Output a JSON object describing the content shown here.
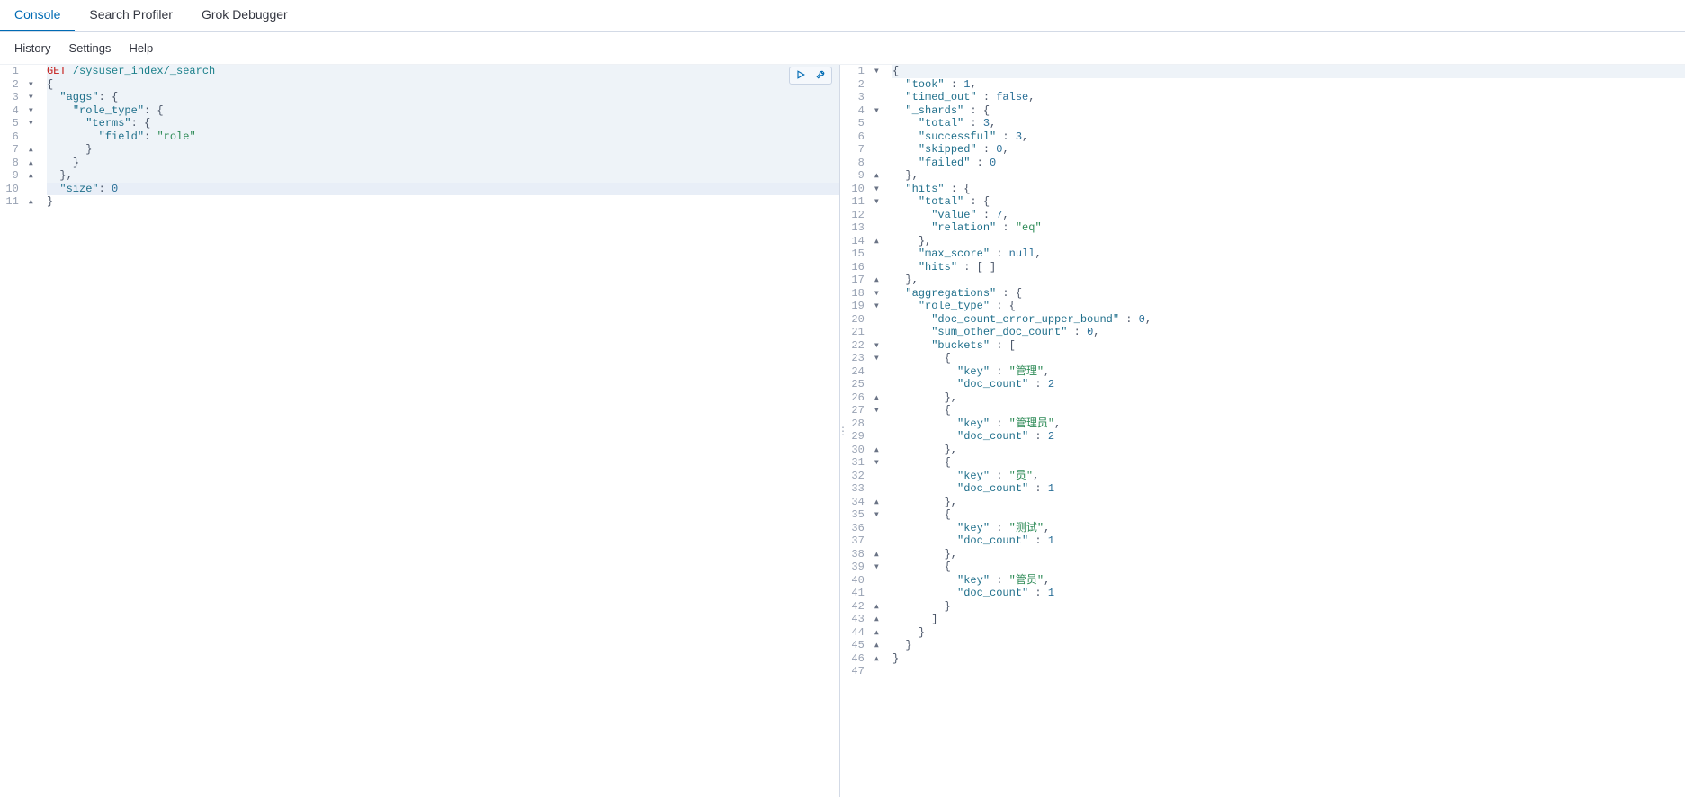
{
  "tabs": {
    "console": "Console",
    "searchProfiler": "Search Profiler",
    "grokDebugger": "Grok Debugger",
    "active": "console"
  },
  "subMenu": {
    "history": "History",
    "settings": "Settings",
    "help": "Help"
  },
  "actions": {
    "runTitle": "Click to send request",
    "wrenchTitle": "Options"
  },
  "request": {
    "method": "GET",
    "path": "/sysuser_index/_search",
    "lines": [
      {
        "n": 1,
        "fold": "",
        "hl": true,
        "tokens": [
          {
            "t": "method",
            "v": "GET"
          },
          {
            "t": "plain",
            "v": " "
          },
          {
            "t": "path",
            "v": "/sysuser_index/_search"
          }
        ]
      },
      {
        "n": 2,
        "fold": "▾",
        "hl": true,
        "tokens": [
          {
            "t": "punc",
            "v": "{"
          }
        ]
      },
      {
        "n": 3,
        "fold": "▾",
        "hl": true,
        "tokens": [
          {
            "t": "plain",
            "v": "  "
          },
          {
            "t": "key",
            "v": "\"aggs\""
          },
          {
            "t": "punc",
            "v": ": {"
          }
        ]
      },
      {
        "n": 4,
        "fold": "▾",
        "hl": true,
        "tokens": [
          {
            "t": "plain",
            "v": "    "
          },
          {
            "t": "key",
            "v": "\"role_type\""
          },
          {
            "t": "punc",
            "v": ": {"
          }
        ]
      },
      {
        "n": 5,
        "fold": "▾",
        "hl": true,
        "tokens": [
          {
            "t": "plain",
            "v": "      "
          },
          {
            "t": "key",
            "v": "\"terms\""
          },
          {
            "t": "punc",
            "v": ": {"
          }
        ]
      },
      {
        "n": 6,
        "fold": "",
        "hl": true,
        "tokens": [
          {
            "t": "plain",
            "v": "        "
          },
          {
            "t": "key",
            "v": "\"field\""
          },
          {
            "t": "punc",
            "v": ": "
          },
          {
            "t": "str",
            "v": "\"role\""
          }
        ]
      },
      {
        "n": 7,
        "fold": "▴",
        "hl": true,
        "tokens": [
          {
            "t": "plain",
            "v": "      "
          },
          {
            "t": "punc",
            "v": "}"
          }
        ]
      },
      {
        "n": 8,
        "fold": "▴",
        "hl": true,
        "tokens": [
          {
            "t": "plain",
            "v": "    "
          },
          {
            "t": "punc",
            "v": "}"
          }
        ]
      },
      {
        "n": 9,
        "fold": "▴",
        "hl": true,
        "tokens": [
          {
            "t": "plain",
            "v": "  "
          },
          {
            "t": "punc",
            "v": "},"
          }
        ]
      },
      {
        "n": 10,
        "fold": "",
        "hl": true,
        "cursor": true,
        "tokens": [
          {
            "t": "plain",
            "v": "  "
          },
          {
            "t": "key",
            "v": "\"size\""
          },
          {
            "t": "punc",
            "v": ": "
          },
          {
            "t": "num",
            "v": "0"
          }
        ]
      },
      {
        "n": 11,
        "fold": "▴",
        "hl": false,
        "tokens": [
          {
            "t": "punc",
            "v": "}"
          }
        ]
      }
    ]
  },
  "response": {
    "lines": [
      {
        "n": 1,
        "fold": "▾",
        "hl": true,
        "tokens": [
          {
            "t": "punc",
            "v": "{"
          }
        ]
      },
      {
        "n": 2,
        "fold": "",
        "tokens": [
          {
            "t": "plain",
            "v": "  "
          },
          {
            "t": "key",
            "v": "\"took\""
          },
          {
            "t": "punc",
            "v": " : "
          },
          {
            "t": "num",
            "v": "1"
          },
          {
            "t": "punc",
            "v": ","
          }
        ]
      },
      {
        "n": 3,
        "fold": "",
        "tokens": [
          {
            "t": "plain",
            "v": "  "
          },
          {
            "t": "key",
            "v": "\"timed_out\""
          },
          {
            "t": "punc",
            "v": " : "
          },
          {
            "t": "bool",
            "v": "false"
          },
          {
            "t": "punc",
            "v": ","
          }
        ]
      },
      {
        "n": 4,
        "fold": "▾",
        "tokens": [
          {
            "t": "plain",
            "v": "  "
          },
          {
            "t": "key",
            "v": "\"_shards\""
          },
          {
            "t": "punc",
            "v": " : {"
          }
        ]
      },
      {
        "n": 5,
        "fold": "",
        "tokens": [
          {
            "t": "plain",
            "v": "    "
          },
          {
            "t": "key",
            "v": "\"total\""
          },
          {
            "t": "punc",
            "v": " : "
          },
          {
            "t": "num",
            "v": "3"
          },
          {
            "t": "punc",
            "v": ","
          }
        ]
      },
      {
        "n": 6,
        "fold": "",
        "tokens": [
          {
            "t": "plain",
            "v": "    "
          },
          {
            "t": "key",
            "v": "\"successful\""
          },
          {
            "t": "punc",
            "v": " : "
          },
          {
            "t": "num",
            "v": "3"
          },
          {
            "t": "punc",
            "v": ","
          }
        ]
      },
      {
        "n": 7,
        "fold": "",
        "tokens": [
          {
            "t": "plain",
            "v": "    "
          },
          {
            "t": "key",
            "v": "\"skipped\""
          },
          {
            "t": "punc",
            "v": " : "
          },
          {
            "t": "num",
            "v": "0"
          },
          {
            "t": "punc",
            "v": ","
          }
        ]
      },
      {
        "n": 8,
        "fold": "",
        "tokens": [
          {
            "t": "plain",
            "v": "    "
          },
          {
            "t": "key",
            "v": "\"failed\""
          },
          {
            "t": "punc",
            "v": " : "
          },
          {
            "t": "num",
            "v": "0"
          }
        ]
      },
      {
        "n": 9,
        "fold": "▴",
        "tokens": [
          {
            "t": "plain",
            "v": "  "
          },
          {
            "t": "punc",
            "v": "},"
          }
        ]
      },
      {
        "n": 10,
        "fold": "▾",
        "tokens": [
          {
            "t": "plain",
            "v": "  "
          },
          {
            "t": "key",
            "v": "\"hits\""
          },
          {
            "t": "punc",
            "v": " : {"
          }
        ]
      },
      {
        "n": 11,
        "fold": "▾",
        "tokens": [
          {
            "t": "plain",
            "v": "    "
          },
          {
            "t": "key",
            "v": "\"total\""
          },
          {
            "t": "punc",
            "v": " : {"
          }
        ]
      },
      {
        "n": 12,
        "fold": "",
        "tokens": [
          {
            "t": "plain",
            "v": "      "
          },
          {
            "t": "key",
            "v": "\"value\""
          },
          {
            "t": "punc",
            "v": " : "
          },
          {
            "t": "num",
            "v": "7"
          },
          {
            "t": "punc",
            "v": ","
          }
        ]
      },
      {
        "n": 13,
        "fold": "",
        "tokens": [
          {
            "t": "plain",
            "v": "      "
          },
          {
            "t": "key",
            "v": "\"relation\""
          },
          {
            "t": "punc",
            "v": " : "
          },
          {
            "t": "str",
            "v": "\"eq\""
          }
        ]
      },
      {
        "n": 14,
        "fold": "▴",
        "tokens": [
          {
            "t": "plain",
            "v": "    "
          },
          {
            "t": "punc",
            "v": "},"
          }
        ]
      },
      {
        "n": 15,
        "fold": "",
        "tokens": [
          {
            "t": "plain",
            "v": "    "
          },
          {
            "t": "key",
            "v": "\"max_score\""
          },
          {
            "t": "punc",
            "v": " : "
          },
          {
            "t": "null",
            "v": "null"
          },
          {
            "t": "punc",
            "v": ","
          }
        ]
      },
      {
        "n": 16,
        "fold": "",
        "tokens": [
          {
            "t": "plain",
            "v": "    "
          },
          {
            "t": "key",
            "v": "\"hits\""
          },
          {
            "t": "punc",
            "v": " : [ ]"
          }
        ]
      },
      {
        "n": 17,
        "fold": "▴",
        "tokens": [
          {
            "t": "plain",
            "v": "  "
          },
          {
            "t": "punc",
            "v": "},"
          }
        ]
      },
      {
        "n": 18,
        "fold": "▾",
        "tokens": [
          {
            "t": "plain",
            "v": "  "
          },
          {
            "t": "key",
            "v": "\"aggregations\""
          },
          {
            "t": "punc",
            "v": " : {"
          }
        ]
      },
      {
        "n": 19,
        "fold": "▾",
        "tokens": [
          {
            "t": "plain",
            "v": "    "
          },
          {
            "t": "key",
            "v": "\"role_type\""
          },
          {
            "t": "punc",
            "v": " : {"
          }
        ]
      },
      {
        "n": 20,
        "fold": "",
        "tokens": [
          {
            "t": "plain",
            "v": "      "
          },
          {
            "t": "key",
            "v": "\"doc_count_error_upper_bound\""
          },
          {
            "t": "punc",
            "v": " : "
          },
          {
            "t": "num",
            "v": "0"
          },
          {
            "t": "punc",
            "v": ","
          }
        ]
      },
      {
        "n": 21,
        "fold": "",
        "tokens": [
          {
            "t": "plain",
            "v": "      "
          },
          {
            "t": "key",
            "v": "\"sum_other_doc_count\""
          },
          {
            "t": "punc",
            "v": " : "
          },
          {
            "t": "num",
            "v": "0"
          },
          {
            "t": "punc",
            "v": ","
          }
        ]
      },
      {
        "n": 22,
        "fold": "▾",
        "tokens": [
          {
            "t": "plain",
            "v": "      "
          },
          {
            "t": "key",
            "v": "\"buckets\""
          },
          {
            "t": "punc",
            "v": " : ["
          }
        ]
      },
      {
        "n": 23,
        "fold": "▾",
        "tokens": [
          {
            "t": "plain",
            "v": "        "
          },
          {
            "t": "punc",
            "v": "{"
          }
        ]
      },
      {
        "n": 24,
        "fold": "",
        "tokens": [
          {
            "t": "plain",
            "v": "          "
          },
          {
            "t": "key",
            "v": "\"key\""
          },
          {
            "t": "punc",
            "v": " : "
          },
          {
            "t": "str",
            "v": "\"管理\""
          },
          {
            "t": "punc",
            "v": ","
          }
        ]
      },
      {
        "n": 25,
        "fold": "",
        "tokens": [
          {
            "t": "plain",
            "v": "          "
          },
          {
            "t": "key",
            "v": "\"doc_count\""
          },
          {
            "t": "punc",
            "v": " : "
          },
          {
            "t": "num",
            "v": "2"
          }
        ]
      },
      {
        "n": 26,
        "fold": "▴",
        "tokens": [
          {
            "t": "plain",
            "v": "        "
          },
          {
            "t": "punc",
            "v": "},"
          }
        ]
      },
      {
        "n": 27,
        "fold": "▾",
        "tokens": [
          {
            "t": "plain",
            "v": "        "
          },
          {
            "t": "punc",
            "v": "{"
          }
        ]
      },
      {
        "n": 28,
        "fold": "",
        "tokens": [
          {
            "t": "plain",
            "v": "          "
          },
          {
            "t": "key",
            "v": "\"key\""
          },
          {
            "t": "punc",
            "v": " : "
          },
          {
            "t": "str",
            "v": "\"管理员\""
          },
          {
            "t": "punc",
            "v": ","
          }
        ]
      },
      {
        "n": 29,
        "fold": "",
        "tokens": [
          {
            "t": "plain",
            "v": "          "
          },
          {
            "t": "key",
            "v": "\"doc_count\""
          },
          {
            "t": "punc",
            "v": " : "
          },
          {
            "t": "num",
            "v": "2"
          }
        ]
      },
      {
        "n": 30,
        "fold": "▴",
        "tokens": [
          {
            "t": "plain",
            "v": "        "
          },
          {
            "t": "punc",
            "v": "},"
          }
        ]
      },
      {
        "n": 31,
        "fold": "▾",
        "tokens": [
          {
            "t": "plain",
            "v": "        "
          },
          {
            "t": "punc",
            "v": "{"
          }
        ]
      },
      {
        "n": 32,
        "fold": "",
        "tokens": [
          {
            "t": "plain",
            "v": "          "
          },
          {
            "t": "key",
            "v": "\"key\""
          },
          {
            "t": "punc",
            "v": " : "
          },
          {
            "t": "str",
            "v": "\"员\""
          },
          {
            "t": "punc",
            "v": ","
          }
        ]
      },
      {
        "n": 33,
        "fold": "",
        "tokens": [
          {
            "t": "plain",
            "v": "          "
          },
          {
            "t": "key",
            "v": "\"doc_count\""
          },
          {
            "t": "punc",
            "v": " : "
          },
          {
            "t": "num",
            "v": "1"
          }
        ]
      },
      {
        "n": 34,
        "fold": "▴",
        "tokens": [
          {
            "t": "plain",
            "v": "        "
          },
          {
            "t": "punc",
            "v": "},"
          }
        ]
      },
      {
        "n": 35,
        "fold": "▾",
        "tokens": [
          {
            "t": "plain",
            "v": "        "
          },
          {
            "t": "punc",
            "v": "{"
          }
        ]
      },
      {
        "n": 36,
        "fold": "",
        "tokens": [
          {
            "t": "plain",
            "v": "          "
          },
          {
            "t": "key",
            "v": "\"key\""
          },
          {
            "t": "punc",
            "v": " : "
          },
          {
            "t": "str",
            "v": "\"测试\""
          },
          {
            "t": "punc",
            "v": ","
          }
        ]
      },
      {
        "n": 37,
        "fold": "",
        "tokens": [
          {
            "t": "plain",
            "v": "          "
          },
          {
            "t": "key",
            "v": "\"doc_count\""
          },
          {
            "t": "punc",
            "v": " : "
          },
          {
            "t": "num",
            "v": "1"
          }
        ]
      },
      {
        "n": 38,
        "fold": "▴",
        "tokens": [
          {
            "t": "plain",
            "v": "        "
          },
          {
            "t": "punc",
            "v": "},"
          }
        ]
      },
      {
        "n": 39,
        "fold": "▾",
        "tokens": [
          {
            "t": "plain",
            "v": "        "
          },
          {
            "t": "punc",
            "v": "{"
          }
        ]
      },
      {
        "n": 40,
        "fold": "",
        "tokens": [
          {
            "t": "plain",
            "v": "          "
          },
          {
            "t": "key",
            "v": "\"key\""
          },
          {
            "t": "punc",
            "v": " : "
          },
          {
            "t": "str",
            "v": "\"管员\""
          },
          {
            "t": "punc",
            "v": ","
          }
        ]
      },
      {
        "n": 41,
        "fold": "",
        "tokens": [
          {
            "t": "plain",
            "v": "          "
          },
          {
            "t": "key",
            "v": "\"doc_count\""
          },
          {
            "t": "punc",
            "v": " : "
          },
          {
            "t": "num",
            "v": "1"
          }
        ]
      },
      {
        "n": 42,
        "fold": "▴",
        "tokens": [
          {
            "t": "plain",
            "v": "        "
          },
          {
            "t": "punc",
            "v": "}"
          }
        ]
      },
      {
        "n": 43,
        "fold": "▴",
        "tokens": [
          {
            "t": "plain",
            "v": "      "
          },
          {
            "t": "punc",
            "v": "]"
          }
        ]
      },
      {
        "n": 44,
        "fold": "▴",
        "tokens": [
          {
            "t": "plain",
            "v": "    "
          },
          {
            "t": "punc",
            "v": "}"
          }
        ]
      },
      {
        "n": 45,
        "fold": "▴",
        "tokens": [
          {
            "t": "plain",
            "v": "  "
          },
          {
            "t": "punc",
            "v": "}"
          }
        ]
      },
      {
        "n": 46,
        "fold": "▴",
        "tokens": [
          {
            "t": "punc",
            "v": "}"
          }
        ]
      },
      {
        "n": 47,
        "fold": "",
        "tokens": []
      }
    ]
  }
}
